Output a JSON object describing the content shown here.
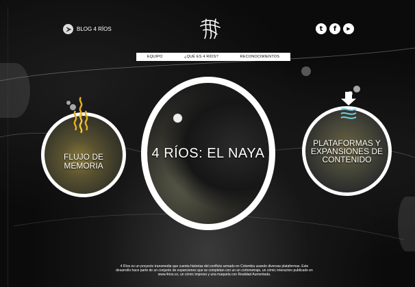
{
  "header": {
    "blog_label": "BLOG 4 RÍOS",
    "logo": "4-rios-logo",
    "social": [
      {
        "name": "twitter-icon",
        "glyph": "t"
      },
      {
        "name": "facebook-icon",
        "glyph": "f"
      },
      {
        "name": "youtube-play-icon",
        "glyph": "▶"
      }
    ]
  },
  "nav": {
    "items": [
      "EQUIPO",
      "¿QUÉ ES 4 RÍOS?",
      "RECONOCIMIENTOS"
    ]
  },
  "sections": {
    "left": {
      "title": "FLUJO DE MEMORIA",
      "icon": "flame-spiral-icon"
    },
    "center": {
      "title": "4 RÍOS: EL NAYA"
    },
    "right": {
      "title": "PLATAFORMAS Y EXPANSIONES DE CONTENIDO",
      "icon": "download-arrow-icon"
    }
  },
  "footer": {
    "text": "4 Ríos es un proyecto transmedia que cuenta historias del conflicto armado en Colombia usando diversas plataformas. Este desarrollo hace parte de un conjunto de expansiones que se completan con un un cortometraje, un cómic interactivo publicado en www.4rios.co, un cómic impreso y una maqueta con Realidad Aumentada."
  },
  "colors": {
    "background": "#0b0b0b",
    "ring": "#ffffff",
    "flame": "#e8b020",
    "arrow": "#6fd3e8"
  }
}
